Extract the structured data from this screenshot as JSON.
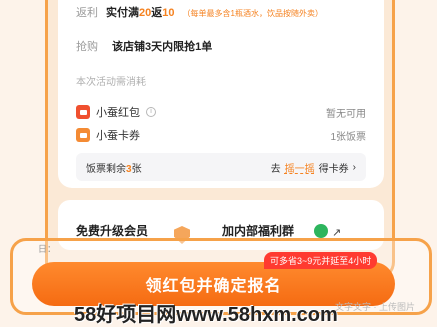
{
  "rebate": {
    "label": "返利",
    "condition_prefix": "实付满",
    "threshold": "20",
    "mid": "返",
    "amount": "10",
    "note": "（每单最多含1瓶酒水，饮品按随外卖）"
  },
  "grab": {
    "label": "抢购",
    "text": "该店铺3天内限抢1单"
  },
  "consume_title": "本次活动需消耗",
  "items": [
    {
      "name": "小蚕红包",
      "info": "i",
      "status": "暂无可用"
    },
    {
      "name": "小蚕卡券",
      "status": "1张饭票"
    }
  ],
  "ticket": {
    "left_prefix": "饭票剩余",
    "count": "3",
    "left_suffix": "张",
    "go": "去",
    "action": "摇一摇",
    "get": "得卡券",
    "chevron": "›"
  },
  "perks": {
    "upgrade": "免费升级会员",
    "group": "加内部福利群",
    "arrow": "↗"
  },
  "footer": {
    "small_text": "日：",
    "cta_label": "领红包并确定报名",
    "badge": "可多省3~9元并延至4小时",
    "faint_text": "文字文字 · 上传图片"
  },
  "watermark": "58好项目网www.58hxm.com"
}
